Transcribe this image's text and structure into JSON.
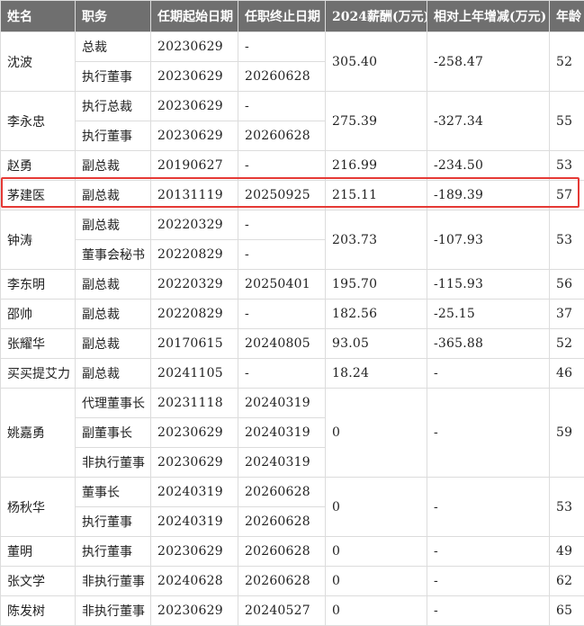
{
  "headers": [
    "姓名",
    "职务",
    "任期起始日期",
    "任职终止日期",
    "2024薪酬(万元)",
    "相对上年增减(万元)",
    "年龄"
  ],
  "people": [
    {
      "name": "沈波",
      "salary": "305.40",
      "change": "-258.47",
      "age": "52",
      "roles": [
        {
          "title": "总裁",
          "start": "20230629",
          "end": "-"
        },
        {
          "title": "执行董事",
          "start": "20230629",
          "end": "20260628"
        }
      ]
    },
    {
      "name": "李永忠",
      "salary": "275.39",
      "change": "-327.34",
      "age": "55",
      "roles": [
        {
          "title": "执行总裁",
          "start": "20230629",
          "end": "-"
        },
        {
          "title": "执行董事",
          "start": "20230629",
          "end": "20260628"
        }
      ]
    },
    {
      "name": "赵勇",
      "salary": "216.99",
      "change": "-234.50",
      "age": "53",
      "roles": [
        {
          "title": "副总裁",
          "start": "20190627",
          "end": "-"
        }
      ]
    },
    {
      "name": "茅建医",
      "salary": "215.11",
      "change": "-189.39",
      "age": "57",
      "roles": [
        {
          "title": "副总裁",
          "start": "20131119",
          "end": "20250925"
        }
      ]
    },
    {
      "name": "钟涛",
      "salary": "203.73",
      "change": "-107.93",
      "age": "53",
      "roles": [
        {
          "title": "副总裁",
          "start": "20220329",
          "end": "-"
        },
        {
          "title": "董事会秘书",
          "start": "20220829",
          "end": "-"
        }
      ]
    },
    {
      "name": "李东明",
      "salary": "195.70",
      "change": "-115.93",
      "age": "56",
      "roles": [
        {
          "title": "副总裁",
          "start": "20220329",
          "end": "20250401"
        }
      ]
    },
    {
      "name": "邵帅",
      "salary": "182.56",
      "change": "-25.15",
      "age": "37",
      "roles": [
        {
          "title": "副总裁",
          "start": "20220829",
          "end": "-"
        }
      ]
    },
    {
      "name": "张耀华",
      "salary": "93.05",
      "change": "-365.88",
      "age": "52",
      "roles": [
        {
          "title": "副总裁",
          "start": "20170615",
          "end": "20240805"
        }
      ]
    },
    {
      "name": "买买提艾力",
      "salary": "18.24",
      "change": "-",
      "age": "46",
      "roles": [
        {
          "title": "副总裁",
          "start": "20241105",
          "end": "-"
        }
      ]
    },
    {
      "name": "姚嘉勇",
      "salary": "0",
      "change": "-",
      "age": "59",
      "roles": [
        {
          "title": "代理董事长",
          "start": "20231118",
          "end": "20240319"
        },
        {
          "title": "副董事长",
          "start": "20230629",
          "end": "20240319"
        },
        {
          "title": "非执行董事",
          "start": "20230629",
          "end": "20240319"
        }
      ]
    },
    {
      "name": "杨秋华",
      "salary": "0",
      "change": "-",
      "age": "53",
      "roles": [
        {
          "title": "董事长",
          "start": "20240319",
          "end": "20260628"
        },
        {
          "title": "执行董事",
          "start": "20240319",
          "end": "20260628"
        }
      ]
    },
    {
      "name": "董明",
      "salary": "0",
      "change": "-",
      "age": "49",
      "roles": [
        {
          "title": "执行董事",
          "start": "20230629",
          "end": "20260628"
        }
      ]
    },
    {
      "name": "张文学",
      "salary": "0",
      "change": "-",
      "age": "62",
      "roles": [
        {
          "title": "非执行董事",
          "start": "20240628",
          "end": "20260628"
        }
      ]
    },
    {
      "name": "陈发树",
      "salary": "0",
      "change": "-",
      "age": "65",
      "roles": [
        {
          "title": "非执行董事",
          "start": "20230629",
          "end": "20240527"
        }
      ]
    }
  ],
  "highlight_name": "茅建医"
}
